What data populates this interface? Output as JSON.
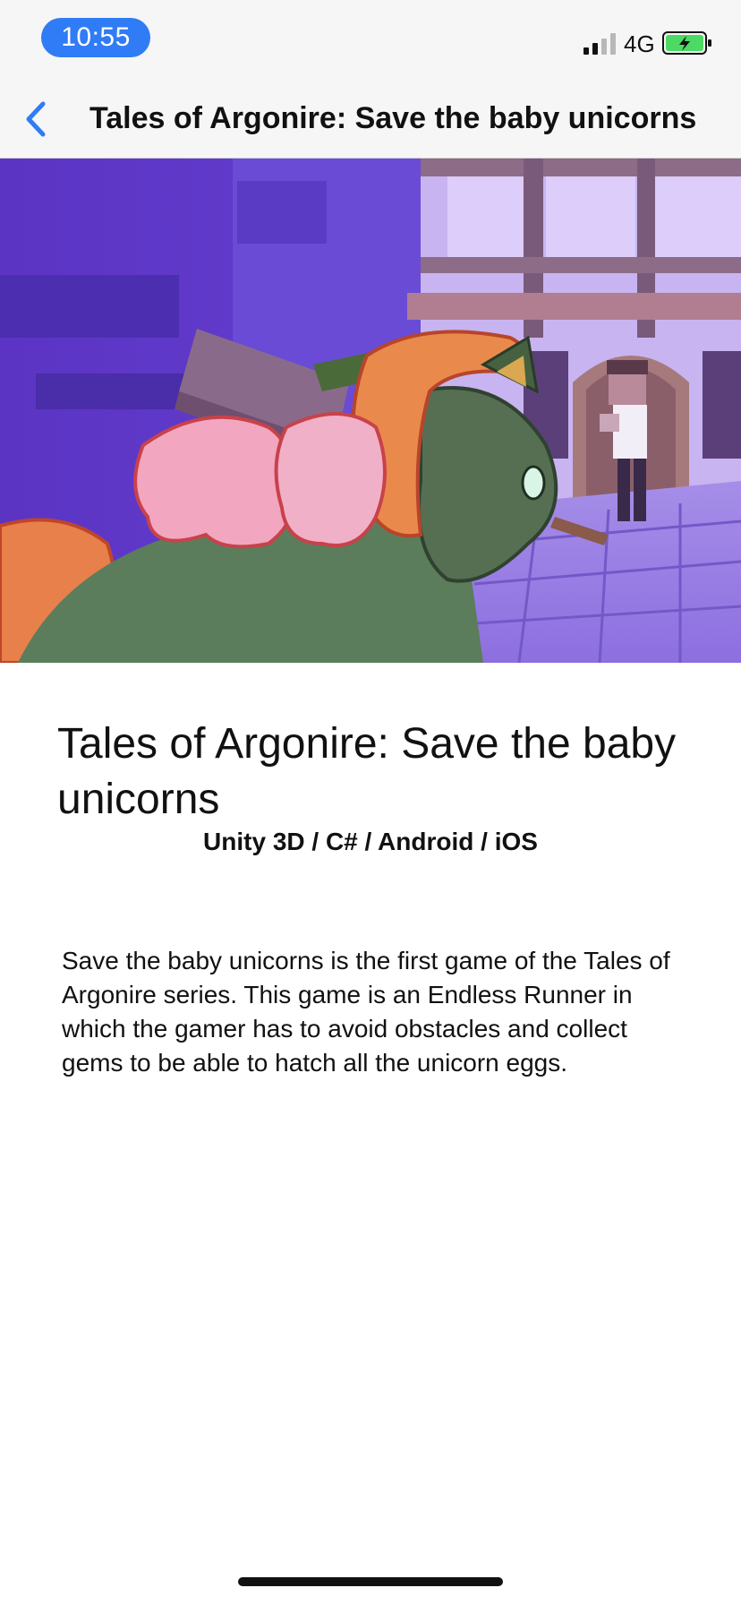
{
  "status_bar": {
    "time": "10:55",
    "network": "4G",
    "signal_icon": "cellular-signal-icon",
    "battery_icon": "battery-charging-icon",
    "accent_color": "#2f7cf6",
    "battery_color": "#4cd964"
  },
  "nav": {
    "back_icon": "chevron-left-icon",
    "title": "Tales of Argonire: Save the baby unicorns"
  },
  "hero": {
    "alt": "Game screenshot of a green unicorn with pink wings in a purple voxel town"
  },
  "content": {
    "title": "Tales of Argonire: Save the baby unicorns",
    "tech_stack": "Unity 3D / C# / Android / iOS",
    "description": "Save the baby unicorns is the first game of the Tales of Argonire series. This game is an Endless Runner in which the gamer has to avoid obstacles and collect gems to be able to hatch all the unicorn eggs."
  }
}
